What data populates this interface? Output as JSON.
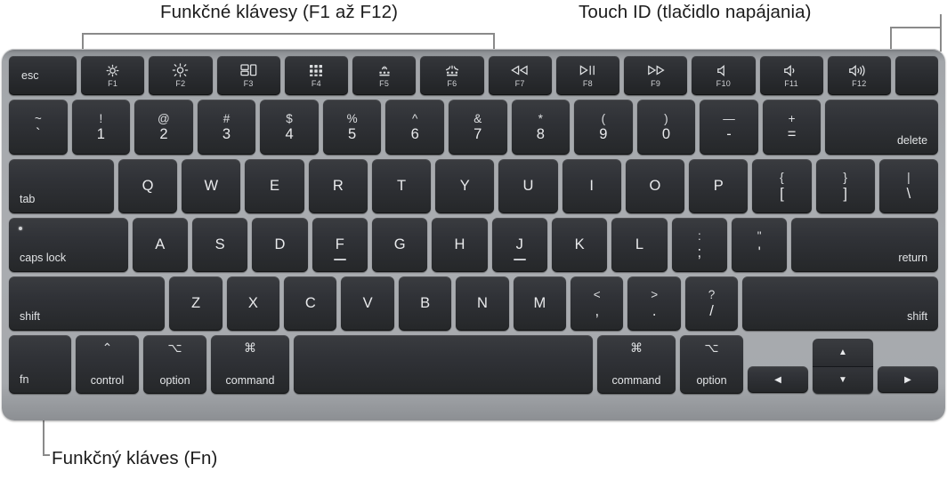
{
  "callouts": {
    "function_keys": "Funkčné klávesy (F1 až F12)",
    "touch_id": "Touch ID (tlačidlo napájania)",
    "fn_key": "Funkčný kláves (Fn)"
  },
  "colors": {
    "page_background": "#ffffff",
    "chassis": "#a8abaf",
    "key_face": "#303237",
    "key_text": "#e9eaec",
    "leader_line": "#8a8a8a",
    "caption_text": "#1b1b1b"
  },
  "keyboard": {
    "layout": "Apple Magic Keyboard (US, MacBook Air with Touch ID)",
    "rows": {
      "function_row": [
        {
          "name": "escape",
          "label": "esc",
          "icon": "",
          "fn_label": ""
        },
        {
          "name": "f1",
          "label": "",
          "icon": "brightness-down-icon",
          "fn_label": "F1"
        },
        {
          "name": "f2",
          "label": "",
          "icon": "brightness-up-icon",
          "fn_label": "F2"
        },
        {
          "name": "f3",
          "label": "",
          "icon": "mission-control-icon",
          "fn_label": "F3"
        },
        {
          "name": "f4",
          "label": "",
          "icon": "spotlight-launchpad-grid-icon",
          "fn_label": "F4"
        },
        {
          "name": "f5",
          "label": "",
          "icon": "keyboard-backlight-down-icon",
          "fn_label": "F5"
        },
        {
          "name": "f6",
          "label": "",
          "icon": "keyboard-backlight-up-icon",
          "fn_label": "F6"
        },
        {
          "name": "f7",
          "label": "",
          "icon": "rewind-icon",
          "fn_label": "F7"
        },
        {
          "name": "f8",
          "label": "",
          "icon": "play-pause-icon",
          "fn_label": "F8"
        },
        {
          "name": "f9",
          "label": "",
          "icon": "fast-forward-icon",
          "fn_label": "F9"
        },
        {
          "name": "f10",
          "label": "",
          "icon": "mute-icon",
          "fn_label": "F10"
        },
        {
          "name": "f11",
          "label": "",
          "icon": "volume-down-icon",
          "fn_label": "F11"
        },
        {
          "name": "f12",
          "label": "",
          "icon": "volume-up-icon",
          "fn_label": "F12"
        },
        {
          "name": "touch-id",
          "label": "",
          "icon": "touch-id-icon",
          "fn_label": ""
        }
      ],
      "number_row": [
        {
          "name": "grave",
          "upper": "~",
          "lower": "`"
        },
        {
          "name": "one",
          "upper": "!",
          "lower": "1"
        },
        {
          "name": "two",
          "upper": "@",
          "lower": "2"
        },
        {
          "name": "three",
          "upper": "#",
          "lower": "3"
        },
        {
          "name": "four",
          "upper": "$",
          "lower": "4"
        },
        {
          "name": "five",
          "upper": "%",
          "lower": "5"
        },
        {
          "name": "six",
          "upper": "^",
          "lower": "6"
        },
        {
          "name": "seven",
          "upper": "&",
          "lower": "7"
        },
        {
          "name": "eight",
          "upper": "*",
          "lower": "8"
        },
        {
          "name": "nine",
          "upper": "(",
          "lower": "9"
        },
        {
          "name": "zero",
          "upper": ")",
          "lower": "0"
        },
        {
          "name": "minus",
          "upper": "—",
          "lower": "-"
        },
        {
          "name": "equals",
          "upper": "+",
          "lower": "="
        },
        {
          "name": "delete",
          "upper": "",
          "lower": "delete"
        }
      ],
      "top_letter_row": [
        {
          "name": "tab",
          "upper": "",
          "lower": "tab"
        },
        {
          "name": "q",
          "upper": "",
          "lower": "Q"
        },
        {
          "name": "w",
          "upper": "",
          "lower": "W"
        },
        {
          "name": "e",
          "upper": "",
          "lower": "E"
        },
        {
          "name": "r",
          "upper": "",
          "lower": "R"
        },
        {
          "name": "t",
          "upper": "",
          "lower": "T"
        },
        {
          "name": "y",
          "upper": "",
          "lower": "Y"
        },
        {
          "name": "u",
          "upper": "",
          "lower": "U"
        },
        {
          "name": "i",
          "upper": "",
          "lower": "I"
        },
        {
          "name": "o",
          "upper": "",
          "lower": "O"
        },
        {
          "name": "p",
          "upper": "",
          "lower": "P"
        },
        {
          "name": "bracket-left",
          "upper": "{",
          "lower": "["
        },
        {
          "name": "bracket-right",
          "upper": "}",
          "lower": "]"
        },
        {
          "name": "backslash",
          "upper": "|",
          "lower": "\\"
        }
      ],
      "home_letter_row": [
        {
          "name": "caps-lock",
          "upper": "",
          "lower": "caps lock"
        },
        {
          "name": "a",
          "upper": "",
          "lower": "A"
        },
        {
          "name": "s",
          "upper": "",
          "lower": "S"
        },
        {
          "name": "d",
          "upper": "",
          "lower": "D"
        },
        {
          "name": "f",
          "upper": "",
          "lower": "F"
        },
        {
          "name": "g",
          "upper": "",
          "lower": "G"
        },
        {
          "name": "h",
          "upper": "",
          "lower": "H"
        },
        {
          "name": "j",
          "upper": "",
          "lower": "J"
        },
        {
          "name": "k",
          "upper": "",
          "lower": "K"
        },
        {
          "name": "l",
          "upper": "",
          "lower": "L"
        },
        {
          "name": "semicolon",
          "upper": ":",
          "lower": ";"
        },
        {
          "name": "quote",
          "upper": "\"",
          "lower": "'"
        },
        {
          "name": "return",
          "upper": "",
          "lower": "return"
        }
      ],
      "bottom_letter_row": [
        {
          "name": "shift-left",
          "upper": "",
          "lower": "shift"
        },
        {
          "name": "z",
          "upper": "",
          "lower": "Z"
        },
        {
          "name": "x",
          "upper": "",
          "lower": "X"
        },
        {
          "name": "c",
          "upper": "",
          "lower": "C"
        },
        {
          "name": "v",
          "upper": "",
          "lower": "V"
        },
        {
          "name": "b",
          "upper": "",
          "lower": "B"
        },
        {
          "name": "n",
          "upper": "",
          "lower": "N"
        },
        {
          "name": "m",
          "upper": "",
          "lower": "M"
        },
        {
          "name": "comma",
          "upper": "<",
          "lower": ","
        },
        {
          "name": "period",
          "upper": ">",
          "lower": "."
        },
        {
          "name": "slash",
          "upper": "?",
          "lower": "/"
        },
        {
          "name": "shift-right",
          "upper": "",
          "lower": "shift"
        }
      ],
      "modifier_row": [
        {
          "name": "fn",
          "symbol": "",
          "label": "fn"
        },
        {
          "name": "control-left",
          "symbol": "⌃",
          "label": "control"
        },
        {
          "name": "option-left",
          "symbol": "⌥",
          "label": "option"
        },
        {
          "name": "command-left",
          "symbol": "⌘",
          "label": "command"
        },
        {
          "name": "space",
          "symbol": "",
          "label": ""
        },
        {
          "name": "command-right",
          "symbol": "⌘",
          "label": "command"
        },
        {
          "name": "option-right",
          "symbol": "⌥",
          "label": "option"
        },
        {
          "name": "arrow-left",
          "symbol": "◀",
          "label": ""
        },
        {
          "name": "arrow-up",
          "symbol": "▲",
          "label": ""
        },
        {
          "name": "arrow-down",
          "symbol": "▼",
          "label": ""
        },
        {
          "name": "arrow-right",
          "symbol": "▶",
          "label": ""
        }
      ]
    }
  }
}
